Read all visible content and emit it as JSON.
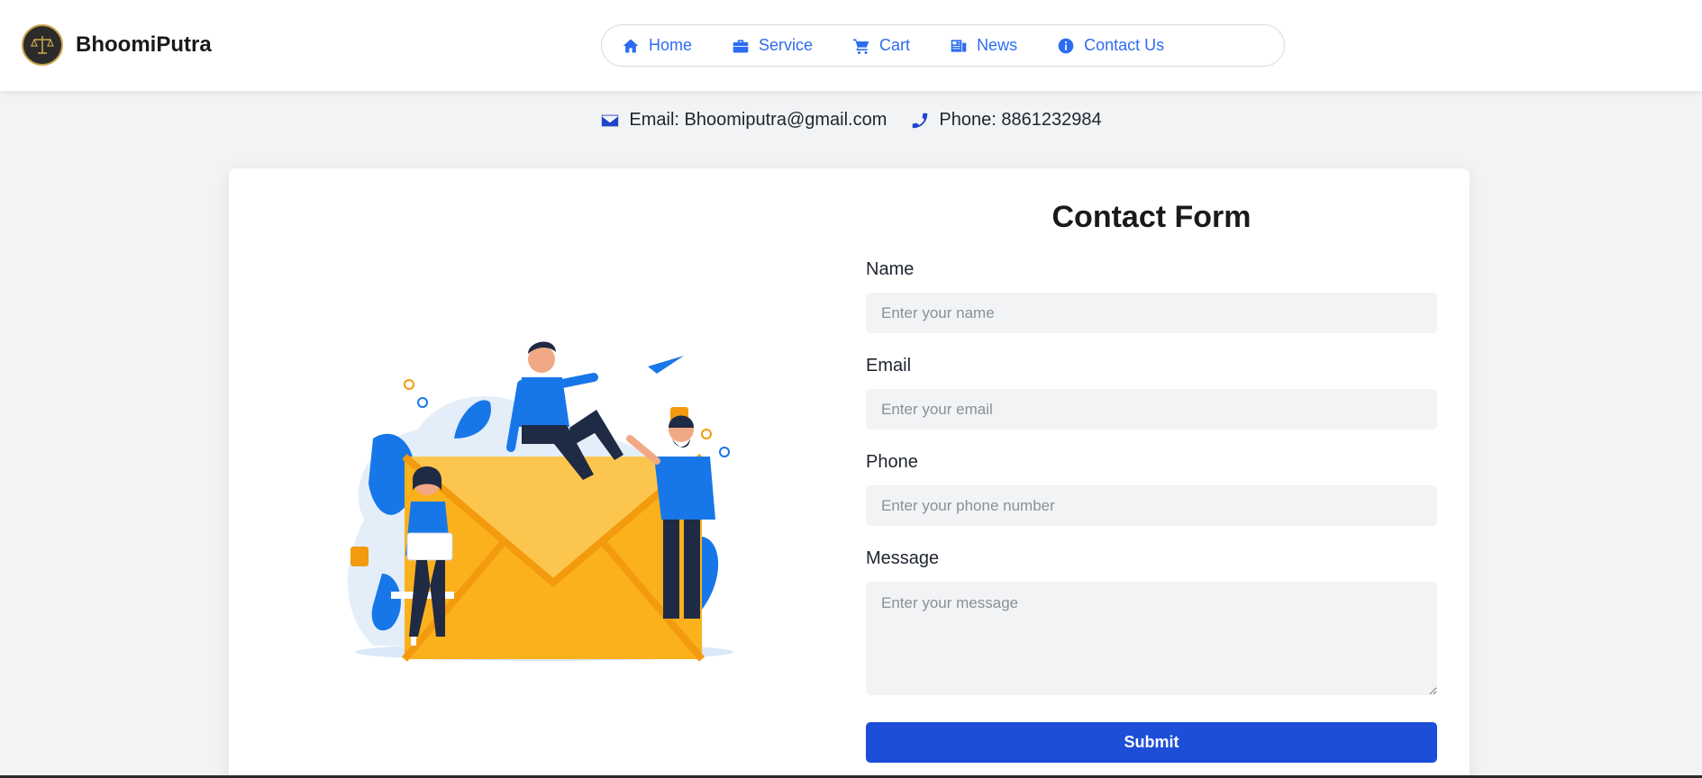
{
  "brand": {
    "name": "BhoomiPutra",
    "logo_icon": "scales-of-justice-logo"
  },
  "nav": {
    "items": [
      {
        "label": "Home",
        "icon": "home-icon"
      },
      {
        "label": "Service",
        "icon": "briefcase-icon"
      },
      {
        "label": "Cart",
        "icon": "cart-icon"
      },
      {
        "label": "News",
        "icon": "news-icon"
      },
      {
        "label": "Contact Us",
        "icon": "info-icon"
      }
    ],
    "color": "#2c6cf0"
  },
  "contact_info": {
    "email": "Email: Bhoomiputra@gmail.com",
    "phone": "Phone: 8861232984"
  },
  "form": {
    "title": "Contact Form",
    "fields": {
      "name": {
        "label": "Name",
        "placeholder": "Enter your name"
      },
      "email": {
        "label": "Email",
        "placeholder": "Enter your email"
      },
      "phone": {
        "label": "Phone",
        "placeholder": "Enter your phone number"
      },
      "message": {
        "label": "Message",
        "placeholder": "Enter your message"
      }
    },
    "submit_label": "Submit",
    "submit_color": "#1d4ed8"
  },
  "illustration": {
    "name": "contact-envelope-people-illustration"
  }
}
